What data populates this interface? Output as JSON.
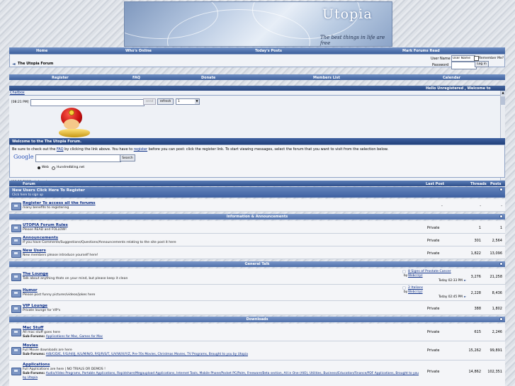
{
  "banner": {
    "title": "Utopia",
    "tagline": "The best things in life are free"
  },
  "navbar": {
    "home": "Home",
    "whos_online": "Who's Online",
    "todays_posts": "Today's Posts",
    "mark_read": "Mark Forums Read"
  },
  "breadcrumb": {
    "title": "The Utopia Forum"
  },
  "login": {
    "username_label": "User Name",
    "username_value": "User Name",
    "remember": "Remember Me?",
    "password_label": "Password",
    "button": "Log in"
  },
  "nav2": {
    "register": "Register",
    "faq": "FAQ",
    "donate": "Donate",
    "members": "Members List",
    "calendar": "Calendar"
  },
  "hello": "Hello Unregistered , Welcome to Utopia, \"Tl",
  "chatbox": {
    "label": "Chatbox",
    "time1": "[08:21 PM]",
    "send": "send",
    "refresh": "refresh",
    "select": "1",
    "time2": "[08:18 PM]",
    "author2": "Dark Angel"
  },
  "welcome": {
    "title": "Welcome to the The Utopia Forum.",
    "text_prefix": "Be sure to check out the ",
    "faq_link": "FAQ",
    "text_mid": " by clicking the link above. You have to ",
    "register_link": "register",
    "text_suffix": " before you can post: click the register link. To start viewing messages, select the forum that you want to visit from the selection below."
  },
  "google": {
    "logo": "Google",
    "button": "Search",
    "opt_web": "Web",
    "opt_site": "Hundredbling.net"
  },
  "table_head": {
    "forum": "Forum",
    "last_post": "Last Post",
    "threads": "Threads",
    "posts": "Posts"
  },
  "new_users_head": {
    "title": "New Users Click Here To Register",
    "sub": "Click here to sign up"
  },
  "register_row": {
    "title": "Register  To access all the forums",
    "desc": "many benefits to registering",
    "lp": "-",
    "threads": "-",
    "posts": "-"
  },
  "cat_info": "Information & Announcements",
  "rows_info": [
    {
      "title": "UTOPIA Forum Rules",
      "desc": "Please READ and FOLLOW!",
      "lp": "Private",
      "threads": "1",
      "posts": "1"
    },
    {
      "title": "Announcements",
      "desc": "If you have Comments/Suggestions/Questions/Announcements relating to the site post it here",
      "lp": "Private",
      "threads": "301",
      "posts": "2,564"
    },
    {
      "title": "New Users",
      "desc": "New members please introduce yourself here!",
      "lp": "Private",
      "threads": "1,822",
      "posts": "13,096"
    }
  ],
  "cat_general": "General Talk",
  "rows_general": [
    {
      "title": "The Lounge",
      "desc": "Talk about anything thats on your mind, but please keep it clean",
      "lp_title": "8 Signs of Prostate Cancer",
      "lp_by": "by",
      "lp_user": "Webcrzyz",
      "lp_time": "Today 02:33 PM",
      "threads": "3,276",
      "posts": "21,258"
    },
    {
      "title": "Humor",
      "desc": "Please post funny pictures/videos/jokes here",
      "lp_title": "2 Italians",
      "lp_by": "by",
      "lp_user": "Webcrzyz",
      "lp_time": "Today 02:45 PM",
      "threads": "2,228",
      "posts": "8,436"
    },
    {
      "title": "VIP Lounge",
      "desc": "Private lounge for VIP's",
      "lp": "Private",
      "threads": "388",
      "posts": "1,802"
    }
  ],
  "cat_downloads": "Downloads",
  "rows_downloads": [
    {
      "title": "Mac Stuff",
      "desc": "All mac stuff goes here",
      "sub_label": "Sub-Forums:",
      "sub": "Applications for Mac, Games for Mac",
      "lp": "Private",
      "threads": "615",
      "posts": "2,246"
    },
    {
      "title": "Movies",
      "desc": "Full Movie downloads are here",
      "sub_label": "Sub-Forums:",
      "sub": "A/B/C/D/E, F/G/H/I/J, K/L/M/N/O, P/Q/R/S/T, U/V/W/X/Y/Z, Pre-70s Movies, Christmas Movies, TV Programs, Brought to you by Utopia",
      "lp": "Private",
      "threads": "15,262",
      "posts": "99,891"
    },
    {
      "title": "Applications",
      "desc": "Full Applications are here | NO TRIALS OR DEMOS !",
      "sub_label": "Sub-Forums:",
      "sub": "Audio/Video Programs, Portable Applications, Rapidshare/Megaupload Applications, Internet Tools, Mobile Phone/Pocket PC/Palm, Freeware/Beta section, All in One (AIO), Utilities, Business/Education/Finance/PDF Applications, Brought to you by Utopia",
      "lp": "Private",
      "threads": "14,862",
      "posts": "102,351"
    }
  ]
}
